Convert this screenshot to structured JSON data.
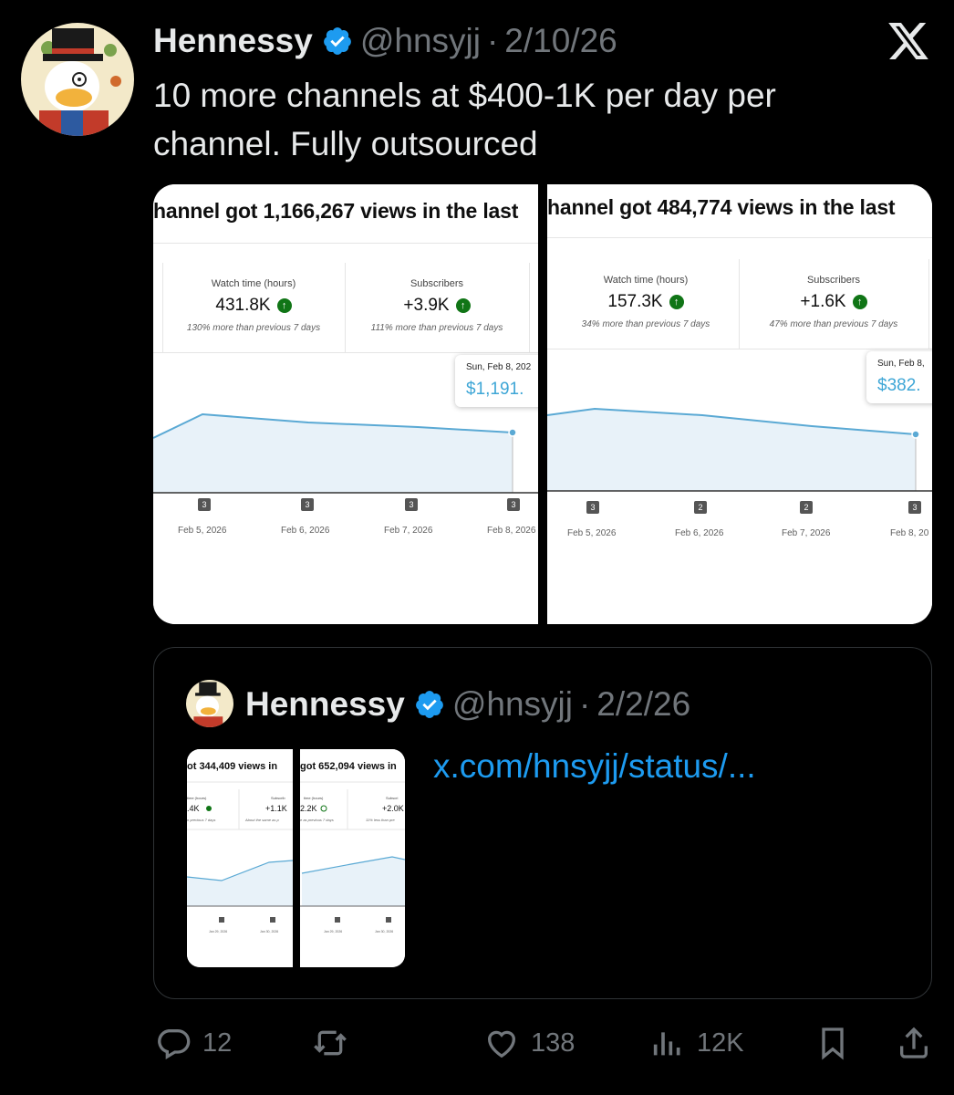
{
  "post": {
    "author_name": "Hennessy",
    "handle": "@hnsyjj",
    "separator": "·",
    "date": "2/10/26",
    "text": "10 more channels at $400-1K per day per channel. Fully outsourced"
  },
  "media": {
    "left": {
      "title": "hannel got 1,166,267 views in the last",
      "metrics": [
        {
          "label": "Watch time (hours)",
          "value": "431.8K",
          "note": "130% more than previous 7 days"
        },
        {
          "label": "Subscribers",
          "value": "+3.9K",
          "note": "111% more than previous 7 days"
        }
      ],
      "tooltip_date": "Sun, Feb 8, 202",
      "tooltip_value": "$1,191.",
      "badges": [
        "3",
        "3",
        "3",
        "3"
      ],
      "dates": [
        "Feb 5, 2026",
        "Feb 6, 2026",
        "Feb 7, 2026",
        "Feb 8, 2026"
      ]
    },
    "right": {
      "title": "hannel got 484,774 views in the last",
      "metrics": [
        {
          "label": "Watch time (hours)",
          "value": "157.3K",
          "note": "34% more than previous 7 days"
        },
        {
          "label": "Subscribers",
          "value": "+1.6K",
          "note": "47% more than previous 7 days"
        }
      ],
      "tooltip_date": "Sun, Feb 8,",
      "tooltip_value": "$382.",
      "badges": [
        "3",
        "2",
        "2",
        "3"
      ],
      "dates": [
        "Feb 5, 2026",
        "Feb 6, 2026",
        "Feb 7, 2026",
        "Feb 8, 20"
      ]
    }
  },
  "quote": {
    "author_name": "Hennessy",
    "handle": "@hnsyjj",
    "separator": "·",
    "date": "2/2/26",
    "link": "x.com/hnsyjj/status/...",
    "thumb": {
      "left_title": "ot 344,409 views in",
      "right_title": "got 652,094 views in",
      "l_label": "time (hours)",
      "l_value": ".4K",
      "l_note": "n previous 7 days",
      "m_label": "Subscrib",
      "m_value": "+1.1K",
      "m_note": "About the same as p",
      "r_label": "time (hours)",
      "r_value": "2.2K",
      "r_note": "e as previous 7 days",
      "r2_label": "Subscri",
      "r2_value": "+2.0K",
      "r2_note": "11% less than pre",
      "dates": [
        "Jan 29, 2026",
        "Jan 30, 2026",
        "Jan 29, 2026",
        "Jan 30, 2026"
      ],
      "badges": [
        "3",
        "3",
        "3",
        "3"
      ]
    }
  },
  "actions": {
    "replies": "12",
    "retweets": "",
    "likes": "138",
    "views": "12K"
  },
  "colors": {
    "background": "#000000",
    "text": "#e7e9ea",
    "muted": "#71767b",
    "link": "#1d9bf0",
    "verified": "#1d9bf0",
    "chart_line": "#5aa9d4",
    "chart_fill": "#e8f2f9"
  },
  "icons": [
    "x-logo-icon",
    "verified-badge-icon",
    "reply-icon",
    "retweet-icon",
    "like-icon",
    "views-icon",
    "bookmark-icon",
    "share-icon"
  ]
}
